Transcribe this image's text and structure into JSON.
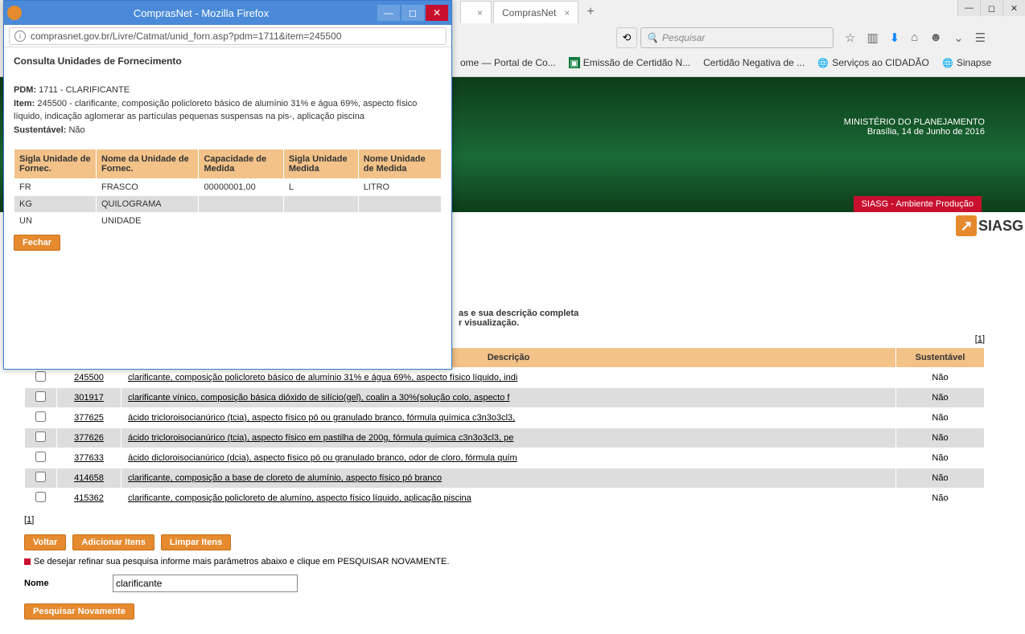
{
  "browser": {
    "tab1_label": "...",
    "tab2_label": "ComprasNet",
    "search_placeholder": "Pesquisar",
    "bookmarks": {
      "b1": "ome — Portal de Co...",
      "b2": "Emissão de Certidão N...",
      "b3": "Certidão Negativa de ...",
      "b4": "Serviços ao CIDADÃO",
      "b5": "Sinapse"
    }
  },
  "header": {
    "ministry": "MINISTÉRIO DO PLANEJAMENTO",
    "date": "Brasília, 14 de Junho de 2016",
    "badge": "SIASG - Ambiente Produção",
    "logo": "SIASG"
  },
  "content": {
    "hint1": "as e sua descrição completa",
    "hint2": "r visualização.",
    "page_num": "1",
    "th_desc": "Descrição",
    "th_sus": "Sustentável",
    "rows": [
      {
        "code": "245500",
        "desc": "clarificante, composição policloreto básico de alumínio 31% e água 69%, aspecto físico líquido, indi",
        "sus": "Não"
      },
      {
        "code": "301917",
        "desc": "clarificante vínico, composição básica dióxido de silício(gel), coalin a 30%(solução colo, aspecto f",
        "sus": "Não"
      },
      {
        "code": "377625",
        "desc": "ácido tricloroisocianúrico (tcia), aspecto físico pó ou granulado branco, fórmula química c3n3o3cl3,",
        "sus": "Não"
      },
      {
        "code": "377626",
        "desc": "ácido tricloroisocianúrico (tcia), aspecto físico em pastilha de 200g, fórmula química c3n3o3cl3, pe",
        "sus": "Não"
      },
      {
        "code": "377633",
        "desc": "ácido dicloroisocianúrico (dcia), aspecto físico pó ou granulado branco, odor de cloro, fórmula quím",
        "sus": "Não"
      },
      {
        "code": "414658",
        "desc": "clarificante, composição a base de cloreto de alumínio, aspecto físico pó branco",
        "sus": "Não"
      },
      {
        "code": "415362",
        "desc": "clarificante, composição policloreto de alumíno, aspecto físico líquido, aplicação piscina",
        "sus": "Não"
      }
    ],
    "btn_voltar": "Voltar",
    "btn_add": "Adicionar Itens",
    "btn_limpar": "Limpar Itens",
    "refine": "Se desejar refinar sua pesquisa informe mais parâmetros abaixo e clique em PESQUISAR NOVAMENTE.",
    "lbl_nome": "Nome",
    "val_nome": "clarificante",
    "btn_pesq": "Pesquisar Novamente"
  },
  "popup": {
    "title": "ComprasNet - Mozilla Firefox",
    "url": "comprasnet.gov.br/Livre/Catmat/unid_forn.asp?pdm=1711&item=245500",
    "h": "Consulta Unidades de Fornecimento",
    "pdm_lbl": "PDM:",
    "pdm": " 1711 - CLARIFICANTE",
    "item_lbl": "Item:",
    "item": " 245500 - clarificante, composição policloreto básico de alumínio 31% e água 69%, aspecto físico líquido, indicação aglomerar as partículas pequenas suspensas na pis-, aplicação piscina",
    "sus_lbl": "Sustentável:",
    "sus": " Não",
    "th1": "Sigla Unidade de Fornec.",
    "th2": "Nome da Unidade de Fornec.",
    "th3": "Capacidade de Medida",
    "th4": "Sigla Unidade Medida",
    "th5": "Nome Unidade de Medida",
    "rows": [
      {
        "c1": "FR",
        "c2": "FRASCO",
        "c3": "00000001,00",
        "c4": "L",
        "c5": "LITRO"
      },
      {
        "c1": "KG",
        "c2": "QUILOGRAMA",
        "c3": "",
        "c4": "",
        "c5": ""
      },
      {
        "c1": "UN",
        "c2": "UNIDADE",
        "c3": "",
        "c4": "",
        "c5": ""
      }
    ],
    "btn": "Fechar"
  }
}
